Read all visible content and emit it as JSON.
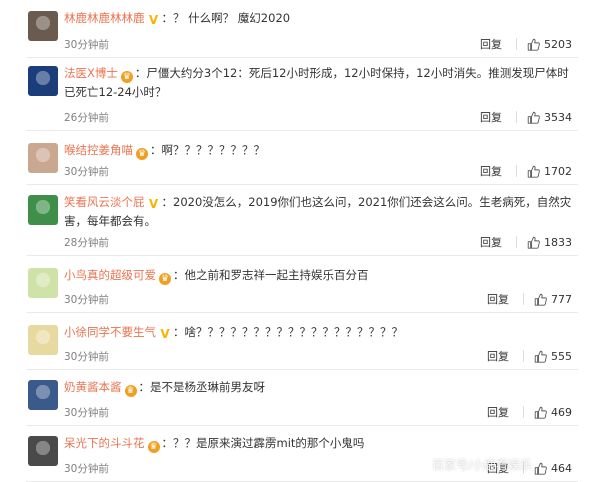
{
  "comments": [
    {
      "username": "林鹿林鹿林林鹿",
      "badge": "V",
      "text": "？ 什么啊？ 魔幻2020",
      "time": "30分钟前",
      "reply_label": "回复",
      "likes": "5203",
      "avatar_color": "#6b5a4e"
    },
    {
      "username": "法医X博士",
      "badge": "crown",
      "text": "尸僵大约分3个12：死后12小时形成，12小时保持，12小时消失。推测发现尸体时已死亡12-24小时？",
      "time": "26分钟前",
      "reply_label": "回复",
      "likes": "3534",
      "avatar_color": "#1b3d7a"
    },
    {
      "username": "喉结控姜角喵",
      "badge": "crown",
      "text": "啊？？？？？？？？",
      "time": "30分钟前",
      "reply_label": "回复",
      "likes": "1702",
      "avatar_color": "#c9a791"
    },
    {
      "username": "笑看风云淡个屁",
      "badge": "V",
      "text": "2020没怎么，2019你们也这么问，2021你们还会这么问。生老病死，自然灾害，每年都会有。",
      "time": "28分钟前",
      "reply_label": "回复",
      "likes": "1833",
      "avatar_color": "#3f8f4a"
    },
    {
      "username": "小鸟真的超级可爱",
      "badge": "crown",
      "text": "他之前和罗志祥一起主持娱乐百分百",
      "time": "30分钟前",
      "reply_label": "回复",
      "likes": "777",
      "avatar_color": "#cfe3a8"
    },
    {
      "username": "小徐同学不要生气",
      "badge": "V",
      "text": "啥？？？？？？？？？？？？？？？？？？",
      "time": "30分钟前",
      "reply_label": "回复",
      "likes": "555",
      "avatar_color": "#e8d9a0"
    },
    {
      "username": "奶黄酱本酱",
      "badge": "crown",
      "text": "是不是杨丞琳前男友呀",
      "time": "30分钟前",
      "reply_label": "回复",
      "likes": "469",
      "avatar_color": "#3a5a8c"
    },
    {
      "username": "呆光下的斗斗花",
      "badge": "crown",
      "text": "？？是原来演过霹雳mit的那个小鬼吗",
      "time": "30分钟前",
      "reply_label": "回复",
      "likes": "464",
      "avatar_color": "#4a4a4a"
    }
  ],
  "watermark": "百家号/小鹿看娱乐"
}
